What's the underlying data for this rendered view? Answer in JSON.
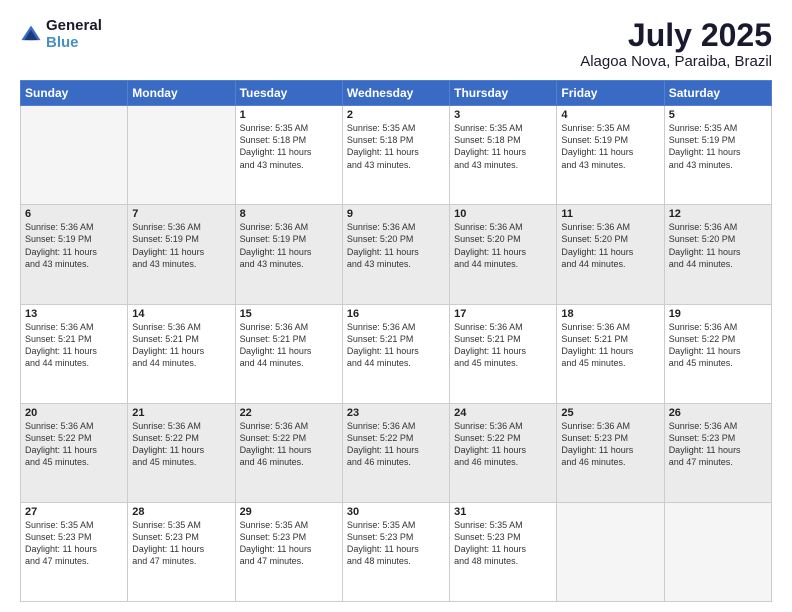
{
  "header": {
    "logo_line1": "General",
    "logo_line2": "Blue",
    "month_year": "July 2025",
    "location": "Alagoa Nova, Paraiba, Brazil"
  },
  "days_of_week": [
    "Sunday",
    "Monday",
    "Tuesday",
    "Wednesday",
    "Thursday",
    "Friday",
    "Saturday"
  ],
  "weeks": [
    [
      {
        "day": "",
        "info": ""
      },
      {
        "day": "",
        "info": ""
      },
      {
        "day": "1",
        "info": "Sunrise: 5:35 AM\nSunset: 5:18 PM\nDaylight: 11 hours\nand 43 minutes."
      },
      {
        "day": "2",
        "info": "Sunrise: 5:35 AM\nSunset: 5:18 PM\nDaylight: 11 hours\nand 43 minutes."
      },
      {
        "day": "3",
        "info": "Sunrise: 5:35 AM\nSunset: 5:18 PM\nDaylight: 11 hours\nand 43 minutes."
      },
      {
        "day": "4",
        "info": "Sunrise: 5:35 AM\nSunset: 5:19 PM\nDaylight: 11 hours\nand 43 minutes."
      },
      {
        "day": "5",
        "info": "Sunrise: 5:35 AM\nSunset: 5:19 PM\nDaylight: 11 hours\nand 43 minutes."
      }
    ],
    [
      {
        "day": "6",
        "info": "Sunrise: 5:36 AM\nSunset: 5:19 PM\nDaylight: 11 hours\nand 43 minutes."
      },
      {
        "day": "7",
        "info": "Sunrise: 5:36 AM\nSunset: 5:19 PM\nDaylight: 11 hours\nand 43 minutes."
      },
      {
        "day": "8",
        "info": "Sunrise: 5:36 AM\nSunset: 5:19 PM\nDaylight: 11 hours\nand 43 minutes."
      },
      {
        "day": "9",
        "info": "Sunrise: 5:36 AM\nSunset: 5:20 PM\nDaylight: 11 hours\nand 43 minutes."
      },
      {
        "day": "10",
        "info": "Sunrise: 5:36 AM\nSunset: 5:20 PM\nDaylight: 11 hours\nand 44 minutes."
      },
      {
        "day": "11",
        "info": "Sunrise: 5:36 AM\nSunset: 5:20 PM\nDaylight: 11 hours\nand 44 minutes."
      },
      {
        "day": "12",
        "info": "Sunrise: 5:36 AM\nSunset: 5:20 PM\nDaylight: 11 hours\nand 44 minutes."
      }
    ],
    [
      {
        "day": "13",
        "info": "Sunrise: 5:36 AM\nSunset: 5:21 PM\nDaylight: 11 hours\nand 44 minutes."
      },
      {
        "day": "14",
        "info": "Sunrise: 5:36 AM\nSunset: 5:21 PM\nDaylight: 11 hours\nand 44 minutes."
      },
      {
        "day": "15",
        "info": "Sunrise: 5:36 AM\nSunset: 5:21 PM\nDaylight: 11 hours\nand 44 minutes."
      },
      {
        "day": "16",
        "info": "Sunrise: 5:36 AM\nSunset: 5:21 PM\nDaylight: 11 hours\nand 44 minutes."
      },
      {
        "day": "17",
        "info": "Sunrise: 5:36 AM\nSunset: 5:21 PM\nDaylight: 11 hours\nand 45 minutes."
      },
      {
        "day": "18",
        "info": "Sunrise: 5:36 AM\nSunset: 5:21 PM\nDaylight: 11 hours\nand 45 minutes."
      },
      {
        "day": "19",
        "info": "Sunrise: 5:36 AM\nSunset: 5:22 PM\nDaylight: 11 hours\nand 45 minutes."
      }
    ],
    [
      {
        "day": "20",
        "info": "Sunrise: 5:36 AM\nSunset: 5:22 PM\nDaylight: 11 hours\nand 45 minutes."
      },
      {
        "day": "21",
        "info": "Sunrise: 5:36 AM\nSunset: 5:22 PM\nDaylight: 11 hours\nand 45 minutes."
      },
      {
        "day": "22",
        "info": "Sunrise: 5:36 AM\nSunset: 5:22 PM\nDaylight: 11 hours\nand 46 minutes."
      },
      {
        "day": "23",
        "info": "Sunrise: 5:36 AM\nSunset: 5:22 PM\nDaylight: 11 hours\nand 46 minutes."
      },
      {
        "day": "24",
        "info": "Sunrise: 5:36 AM\nSunset: 5:22 PM\nDaylight: 11 hours\nand 46 minutes."
      },
      {
        "day": "25",
        "info": "Sunrise: 5:36 AM\nSunset: 5:23 PM\nDaylight: 11 hours\nand 46 minutes."
      },
      {
        "day": "26",
        "info": "Sunrise: 5:36 AM\nSunset: 5:23 PM\nDaylight: 11 hours\nand 47 minutes."
      }
    ],
    [
      {
        "day": "27",
        "info": "Sunrise: 5:35 AM\nSunset: 5:23 PM\nDaylight: 11 hours\nand 47 minutes."
      },
      {
        "day": "28",
        "info": "Sunrise: 5:35 AM\nSunset: 5:23 PM\nDaylight: 11 hours\nand 47 minutes."
      },
      {
        "day": "29",
        "info": "Sunrise: 5:35 AM\nSunset: 5:23 PM\nDaylight: 11 hours\nand 47 minutes."
      },
      {
        "day": "30",
        "info": "Sunrise: 5:35 AM\nSunset: 5:23 PM\nDaylight: 11 hours\nand 48 minutes."
      },
      {
        "day": "31",
        "info": "Sunrise: 5:35 AM\nSunset: 5:23 PM\nDaylight: 11 hours\nand 48 minutes."
      },
      {
        "day": "",
        "info": ""
      },
      {
        "day": "",
        "info": ""
      }
    ]
  ]
}
